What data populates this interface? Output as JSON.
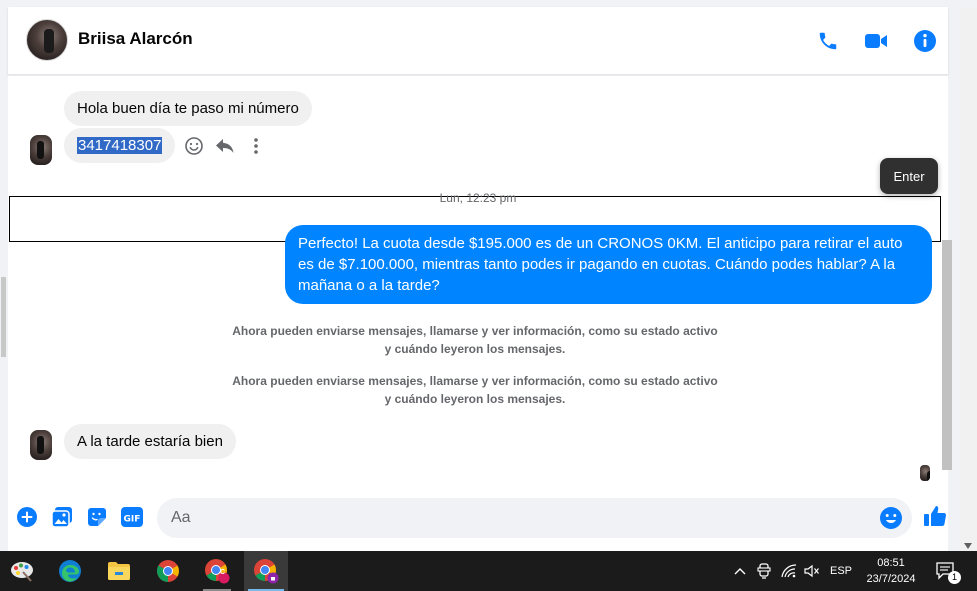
{
  "contact": {
    "name": "Briisa Alarcón"
  },
  "messages": {
    "incoming_1": "Hola buen día te paso mi número",
    "incoming_2": "3417418307",
    "timestamp": "Lun, 12:23 pm",
    "outgoing_1": "Perfecto! La cuota desde $195.000 es de un CRONOS 0KM. El anticipo para retirar el auto es de $7.100.000, mientras tanto podes ir pagando en cuotas. Cuándo podes hablar? A la mañana o a la tarde?",
    "system_1": "Ahora pueden enviarse mensajes, llamarse y ver información, como su estado activo y cuándo leyeron los mensajes.",
    "system_2": "Ahora pueden enviarse mensajes, llamarse y ver información, como su estado activo y cuándo leyeron los mensajes.",
    "incoming_3": "A la tarde estaría bien"
  },
  "tooltip": "Enter",
  "composer": {
    "placeholder": "Aa"
  },
  "taskbar": {
    "language": "ESP",
    "time": "08:51",
    "date": "23/7/2024",
    "notification_count": "1",
    "chrome_badge": "C"
  },
  "colors": {
    "accent": "#0084ff",
    "incoming_bubble": "#f0f0f0",
    "selection": "#3169c6"
  }
}
